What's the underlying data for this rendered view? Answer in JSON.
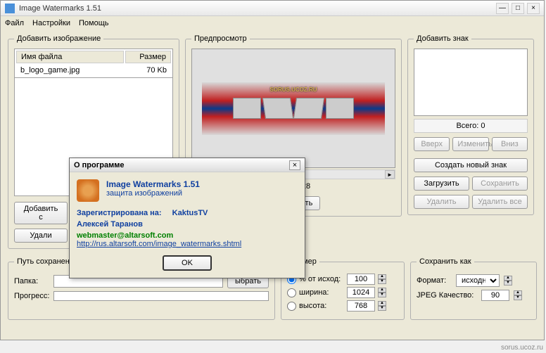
{
  "window": {
    "title": "Image Watermarks 1.51"
  },
  "menu": {
    "file": "Файл",
    "settings": "Настройки",
    "help": "Помощь"
  },
  "left": {
    "legend": "Добавить изображение",
    "col_name": "Имя файла",
    "col_size": "Размер",
    "row_name": "b_logo_game.jpg",
    "row_size": "70 Kb",
    "add_btn": "Добавить с",
    "del_btn": "Удали"
  },
  "mid": {
    "legend": "Предпросмотр",
    "preview_text": "SORUS.UCOZ.RU",
    "dimensions": "783 x 228",
    "save_btn": "Сохранить"
  },
  "right": {
    "legend": "Добавить знак",
    "total": "Всего: 0",
    "up": "Вверх",
    "edit": "Изменить",
    "down": "Вниз",
    "create": "Создать новый знак",
    "load": "Загрузить",
    "save": "Сохранить",
    "delete": "Удалить",
    "delete_all": "Удалить все"
  },
  "path": {
    "legend": "Путь сохранен",
    "folder_label": "Папка:",
    "folder_value": "",
    "select_btn": "ыбрать",
    "progress_label": "Прогресс:"
  },
  "size": {
    "legend": "Размер",
    "pct": "% от исход:",
    "pct_val": "100",
    "width": "ширина:",
    "width_val": "1024",
    "height": "высота:",
    "height_val": "768"
  },
  "saveas": {
    "legend": "Сохранить как",
    "format_label": "Формат:",
    "format_val": "исходн",
    "quality_label": "JPEG Качество:",
    "quality_val": "90"
  },
  "about": {
    "title": "О программе",
    "app": "Image Watermarks 1.51",
    "sub": "защита изображений",
    "reg_label": "Зарегистрирована на:",
    "reg_val": "KaktusTV",
    "author": "Алексей Таранов",
    "email": "webmaster@altarsoft.com",
    "link": "http://rus.altarsoft.com/image_watermarks.shtml",
    "ok": "OK"
  },
  "footer": "sorus.ucoz.ru"
}
